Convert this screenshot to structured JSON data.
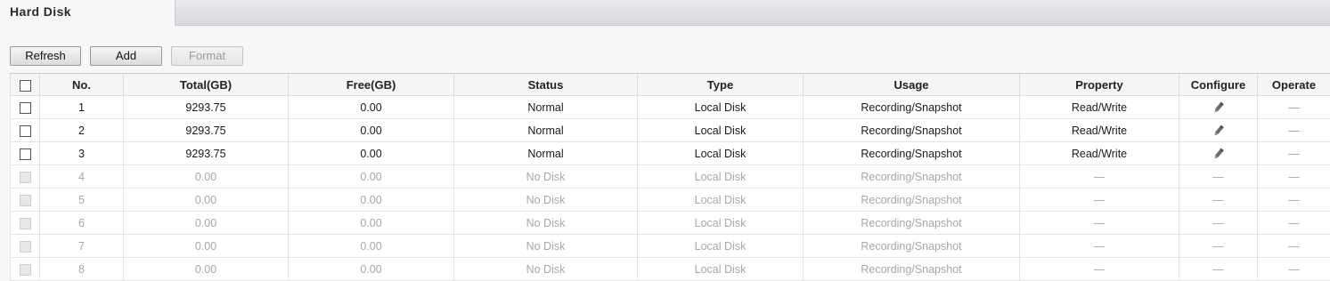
{
  "tab": {
    "title": "Hard Disk"
  },
  "toolbar": {
    "refresh": "Refresh",
    "add": "Add",
    "format": "Format"
  },
  "table": {
    "headers": [
      "No.",
      "Total(GB)",
      "Free(GB)",
      "Status",
      "Type",
      "Usage",
      "Property",
      "Configure",
      "Operate"
    ],
    "rows": [
      {
        "no": "1",
        "total": "9293.75",
        "free": "0.00",
        "status": "Normal",
        "type": "Local Disk",
        "usage": "Recording/Snapshot",
        "property": "Read/Write",
        "configure": "edit",
        "operate": "—",
        "active": true
      },
      {
        "no": "2",
        "total": "9293.75",
        "free": "0.00",
        "status": "Normal",
        "type": "Local Disk",
        "usage": "Recording/Snapshot",
        "property": "Read/Write",
        "configure": "edit",
        "operate": "—",
        "active": true
      },
      {
        "no": "3",
        "total": "9293.75",
        "free": "0.00",
        "status": "Normal",
        "type": "Local Disk",
        "usage": "Recording/Snapshot",
        "property": "Read/Write",
        "configure": "edit",
        "operate": "—",
        "active": true
      },
      {
        "no": "4",
        "total": "0.00",
        "free": "0.00",
        "status": "No Disk",
        "type": "Local Disk",
        "usage": "Recording/Snapshot",
        "property": "—",
        "configure": "—",
        "operate": "—",
        "active": false
      },
      {
        "no": "5",
        "total": "0.00",
        "free": "0.00",
        "status": "No Disk",
        "type": "Local Disk",
        "usage": "Recording/Snapshot",
        "property": "—",
        "configure": "—",
        "operate": "—",
        "active": false
      },
      {
        "no": "6",
        "total": "0.00",
        "free": "0.00",
        "status": "No Disk",
        "type": "Local Disk",
        "usage": "Recording/Snapshot",
        "property": "—",
        "configure": "—",
        "operate": "—",
        "active": false
      },
      {
        "no": "7",
        "total": "0.00",
        "free": "0.00",
        "status": "No Disk",
        "type": "Local Disk",
        "usage": "Recording/Snapshot",
        "property": "—",
        "configure": "—",
        "operate": "—",
        "active": false
      },
      {
        "no": "8",
        "total": "0.00",
        "free": "0.00",
        "status": "No Disk",
        "type": "Local Disk",
        "usage": "Recording/Snapshot",
        "property": "—",
        "configure": "—",
        "operate": "—",
        "active": false
      }
    ]
  }
}
